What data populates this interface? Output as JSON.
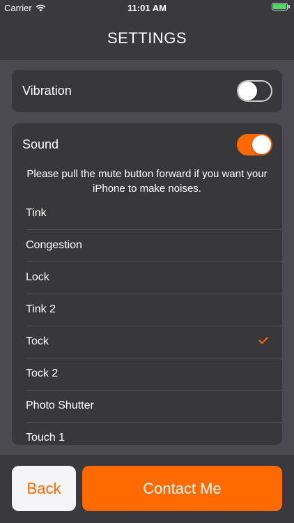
{
  "status_bar": {
    "carrier": "Carrier",
    "time": "11:01 AM",
    "battery_percent": 100,
    "icons": [
      "wifi-icon",
      "battery-icon"
    ]
  },
  "nav": {
    "title": "SETTINGS"
  },
  "vibration": {
    "label": "Vibration",
    "enabled": false
  },
  "sound": {
    "label": "Sound",
    "enabled": true,
    "note": "Please pull the mute button forward if you want your iPhone to make noises.",
    "items": [
      {
        "label": "Tink",
        "selected": false
      },
      {
        "label": "Congestion",
        "selected": false
      },
      {
        "label": "Lock",
        "selected": false
      },
      {
        "label": "Tink 2",
        "selected": false
      },
      {
        "label": "Tock",
        "selected": true
      },
      {
        "label": "Tock 2",
        "selected": false
      },
      {
        "label": "Photo Shutter",
        "selected": false
      },
      {
        "label": "Touch 1",
        "selected": false
      }
    ]
  },
  "buttons": {
    "back_label": "Back",
    "contact_label": "Contact Me"
  },
  "colors": {
    "accent": "#ff6a00",
    "background": "#39393e",
    "card": "#38383c",
    "content_background": "#4a4a50"
  }
}
